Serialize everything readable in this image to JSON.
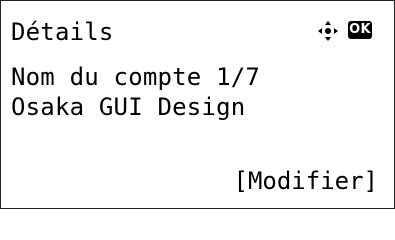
{
  "screen": {
    "title": "Détails",
    "subtitle": "Nom du compte 1/7",
    "value": "Osaka GUI Design",
    "softkey": "[Modifier]",
    "icons": {
      "navigation": "directional-pad-icon",
      "ok": "ok-key-icon"
    },
    "ok_label": "OK",
    "colors": {
      "text": "#000000",
      "background": "#ffffff",
      "ok_badge": "#000000"
    }
  }
}
